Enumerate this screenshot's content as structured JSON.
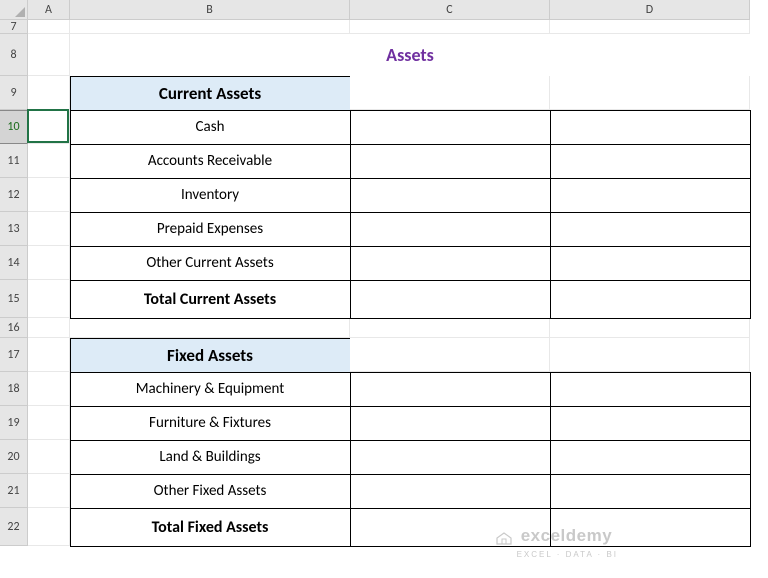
{
  "columns": [
    "A",
    "B",
    "C",
    "D"
  ],
  "rows": [
    "7",
    "8",
    "9",
    "10",
    "11",
    "12",
    "13",
    "14",
    "15",
    "16",
    "17",
    "18",
    "19",
    "20",
    "21",
    "22"
  ],
  "selectedRow": "10",
  "title": "Assets",
  "sections": [
    {
      "header": "Current Assets",
      "items": [
        "Cash",
        "Accounts Receivable",
        "Inventory",
        "Prepaid Expenses",
        "Other Current Assets"
      ],
      "total": "Total Current Assets"
    },
    {
      "header": "Fixed Assets",
      "items": [
        "Machinery & Equipment",
        "Furniture & Fixtures",
        "Land & Buildings",
        "Other Fixed Assets"
      ],
      "total": "Total Fixed Assets"
    }
  ],
  "watermark": {
    "brand": "exceldemy",
    "tag": "EXCEL · DATA · BI"
  }
}
